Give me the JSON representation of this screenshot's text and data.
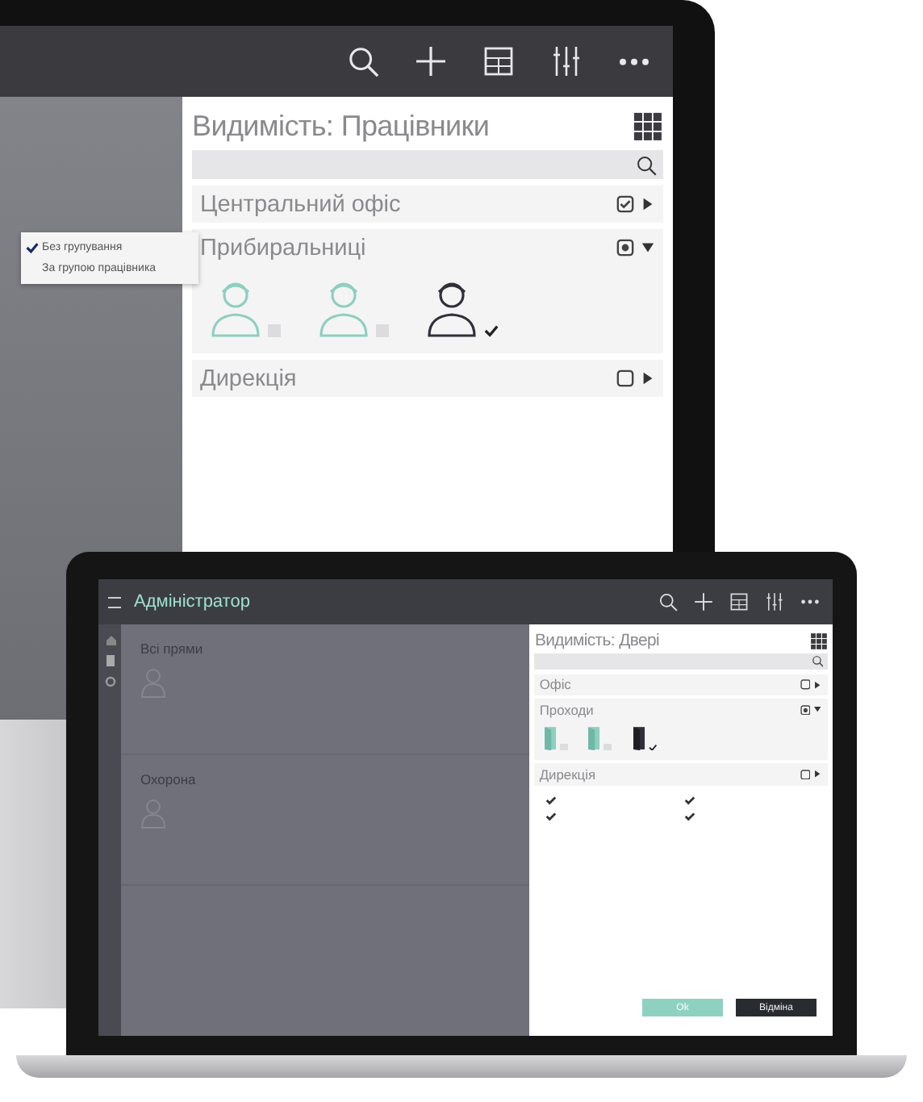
{
  "monitor": {
    "menu": [
      {
        "label": "Без групування",
        "selected": true
      },
      {
        "label": "За групою працівника",
        "selected": false
      }
    ],
    "panel": {
      "title": "Видимість: Працівники",
      "groups": [
        {
          "name": "Центральний офіс",
          "checked": true,
          "partial": false,
          "expanded": false
        },
        {
          "name": "Прибиральниці",
          "checked": false,
          "partial": true,
          "expanded": true,
          "members": [
            {
              "kind": "person",
              "checked": false
            },
            {
              "kind": "person",
              "checked": false
            },
            {
              "kind": "person",
              "checked": true
            }
          ]
        },
        {
          "name": "Дирекція",
          "checked": false,
          "partial": false,
          "expanded": false
        }
      ]
    }
  },
  "laptop": {
    "title": "Адміністратор",
    "sections": [
      {
        "name": "Всі прями"
      },
      {
        "name": "Охорона"
      }
    ],
    "panel": {
      "title": "Видимість: Двері",
      "groups": [
        {
          "name": "Офіс",
          "checked": false,
          "partial": false,
          "expanded": false
        },
        {
          "name": "Проходи",
          "checked": false,
          "partial": true,
          "expanded": true,
          "members": [
            {
              "kind": "door",
              "checked": false
            },
            {
              "kind": "door",
              "checked": false
            },
            {
              "kind": "door",
              "checked": true
            }
          ]
        },
        {
          "name": "Дирекція",
          "checked": false,
          "partial": false,
          "expanded": false
        }
      ]
    },
    "options": [
      {
        "checked": true
      },
      {
        "checked": true
      },
      {
        "checked": true
      },
      {
        "checked": true
      }
    ],
    "buttons": [
      {
        "label": "Ok",
        "kind": "primary"
      },
      {
        "label": "Відміна",
        "kind": "secondary"
      }
    ]
  }
}
